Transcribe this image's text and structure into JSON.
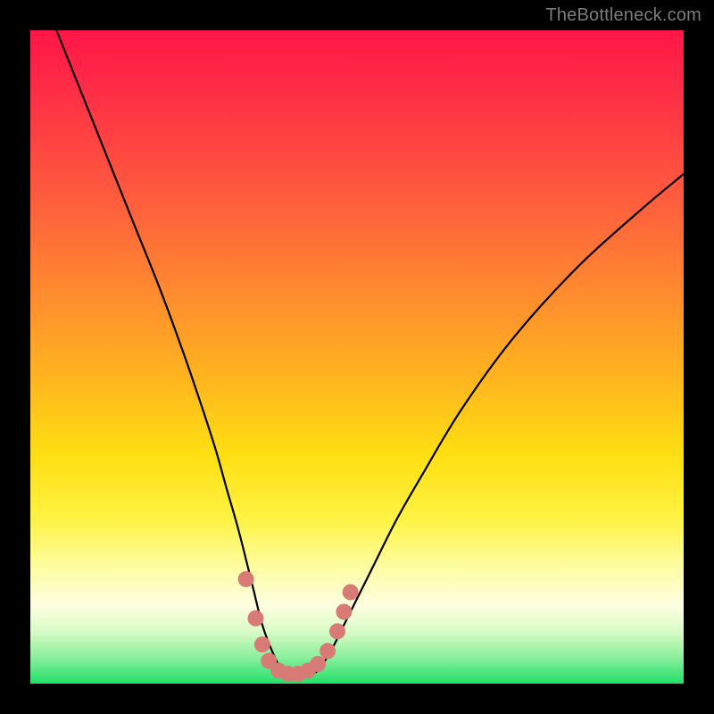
{
  "watermark": "TheBottleneck.com",
  "gradient_colors": {
    "top": "#ff1646",
    "mid_orange": "#ff8a2f",
    "mid_yellow": "#ffdf12",
    "pale": "#fdfee0",
    "bottom_green": "#22e06a"
  },
  "chart_data": {
    "type": "line",
    "title": "",
    "xlabel": "",
    "ylabel": "",
    "xlim": [
      0,
      100
    ],
    "ylim": [
      0,
      100
    ],
    "series": [
      {
        "name": "bottleneck-curve",
        "x": [
          4,
          8,
          12,
          16,
          20,
          24,
          28,
          30,
          32,
          34,
          35.5,
          37,
          38.5,
          40,
          41,
          42,
          44,
          46,
          48,
          52,
          56,
          60,
          66,
          74,
          84,
          94,
          100
        ],
        "y": [
          100,
          90,
          80,
          70,
          60,
          49,
          37,
          30,
          23,
          15,
          9,
          5,
          2,
          1,
          1,
          1,
          2,
          5,
          9,
          17,
          25,
          32,
          42,
          53,
          64,
          73,
          78
        ]
      }
    ],
    "markers": {
      "name": "highlight-dots",
      "color": "#d87a76",
      "points": [
        {
          "x": 33.0,
          "y": 16
        },
        {
          "x": 34.5,
          "y": 10
        },
        {
          "x": 35.5,
          "y": 6
        },
        {
          "x": 36.5,
          "y": 3.5
        },
        {
          "x": 38.0,
          "y": 2
        },
        {
          "x": 39.5,
          "y": 1.5
        },
        {
          "x": 41.0,
          "y": 1.5
        },
        {
          "x": 42.5,
          "y": 2
        },
        {
          "x": 44.0,
          "y": 3
        },
        {
          "x": 45.5,
          "y": 5
        },
        {
          "x": 47.0,
          "y": 8
        },
        {
          "x": 48.0,
          "y": 11
        },
        {
          "x": 49.0,
          "y": 14
        }
      ]
    }
  }
}
